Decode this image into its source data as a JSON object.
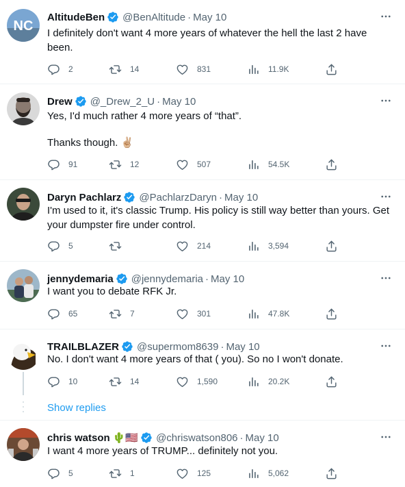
{
  "tweets": [
    {
      "display_name": "AltitudeBen",
      "handle": "@BenAltitude",
      "separator": "·",
      "date": "May 10",
      "text": "I definitely don't want 4 more years of whatever the hell the last 2 have been.",
      "replies": "2",
      "retweets": "14",
      "likes": "831",
      "views": "11.9K"
    },
    {
      "display_name": "Drew",
      "handle": "@_Drew_2_U",
      "separator": "·",
      "date": "May 10",
      "text": "Yes, I'd much rather 4 more years of “that”.",
      "text2": "Thanks though. ✌🏼",
      "replies": "91",
      "retweets": "12",
      "likes": "507",
      "views": "54.5K"
    },
    {
      "display_name": "Daryn Pachlarz",
      "handle": "@PachlarzDaryn",
      "separator": "·",
      "date": "May 10",
      "text": "I'm used to it, it's classic Trump. His policy is still way better than yours. Get your dumpster fire under control.",
      "replies": "5",
      "retweets": "",
      "likes": "214",
      "views": "3,594"
    },
    {
      "display_name": "jennydemaria",
      "handle": "@jennydemaria",
      "separator": "·",
      "date": "May 10",
      "text": "I want you to debate RFK Jr.",
      "replies": "65",
      "retweets": "7",
      "likes": "301",
      "views": "47.8K"
    },
    {
      "display_name": "TRAILBLAZER",
      "handle": "@supermom8639",
      "separator": "·",
      "date": "May 10",
      "text": "No. I don't want 4 more years of that ( you).  So no I won't donate.",
      "replies": "10",
      "retweets": "14",
      "likes": "1,590",
      "views": "20.2K"
    },
    {
      "display_name": "chris watson",
      "name_emoji": "🌵🇺🇸",
      "handle": "@chriswatson806",
      "separator": "·",
      "date": "May 10",
      "text": "I want 4 more years of TRUMP... definitely not you.",
      "replies": "5",
      "retweets": "1",
      "likes": "125",
      "views": "5,062"
    }
  ],
  "show_replies_label": "Show replies",
  "icons": [
    "verified-badge-icon",
    "more-icon",
    "reply-icon",
    "retweet-icon",
    "like-icon",
    "views-icon",
    "share-icon"
  ],
  "colors": {
    "accent": "#1d9bf0",
    "secondary_text": "#536471",
    "primary_text": "#0f1419",
    "divider": "#eff3f4"
  }
}
